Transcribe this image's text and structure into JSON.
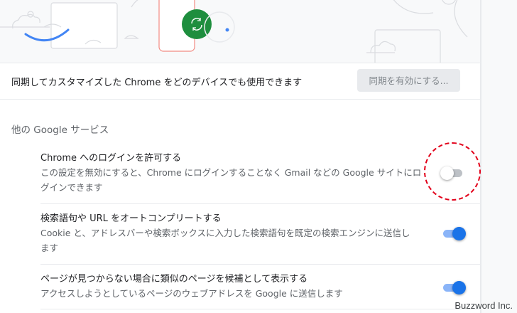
{
  "sync": {
    "description": "同期してカスタマイズした Chrome をどのデバイスでも使用できます",
    "button_label": "同期を有効にする..."
  },
  "section": {
    "title": "他の Google サービス"
  },
  "settings": [
    {
      "title": "Chrome へのログインを許可する",
      "desc_line1": "この設定を無効にすると、Chrome にログインすることなく Gmail などの Google サイトにロ",
      "desc_line2": "グインできます",
      "enabled": false
    },
    {
      "title": "検索語句や URL をオートコンプリートする",
      "desc_line1": "Cookie と、アドレスバーや検索ボックスに入力した検索語句を既定の検索エンジンに送信し",
      "desc_line2": "ます",
      "enabled": true
    },
    {
      "title": "ページが見つからない場合に類似のページを候補として表示する",
      "desc_line1": "アクセスしようとしているページのウェブアドレスを Google に送信します",
      "enabled": true
    }
  ],
  "colors": {
    "accent": "#1a73e8",
    "annotation": "#e2001a",
    "banner_green": "#1e8e3e",
    "banner_blue": "#4285f4"
  },
  "watermark": "Buzzword Inc."
}
